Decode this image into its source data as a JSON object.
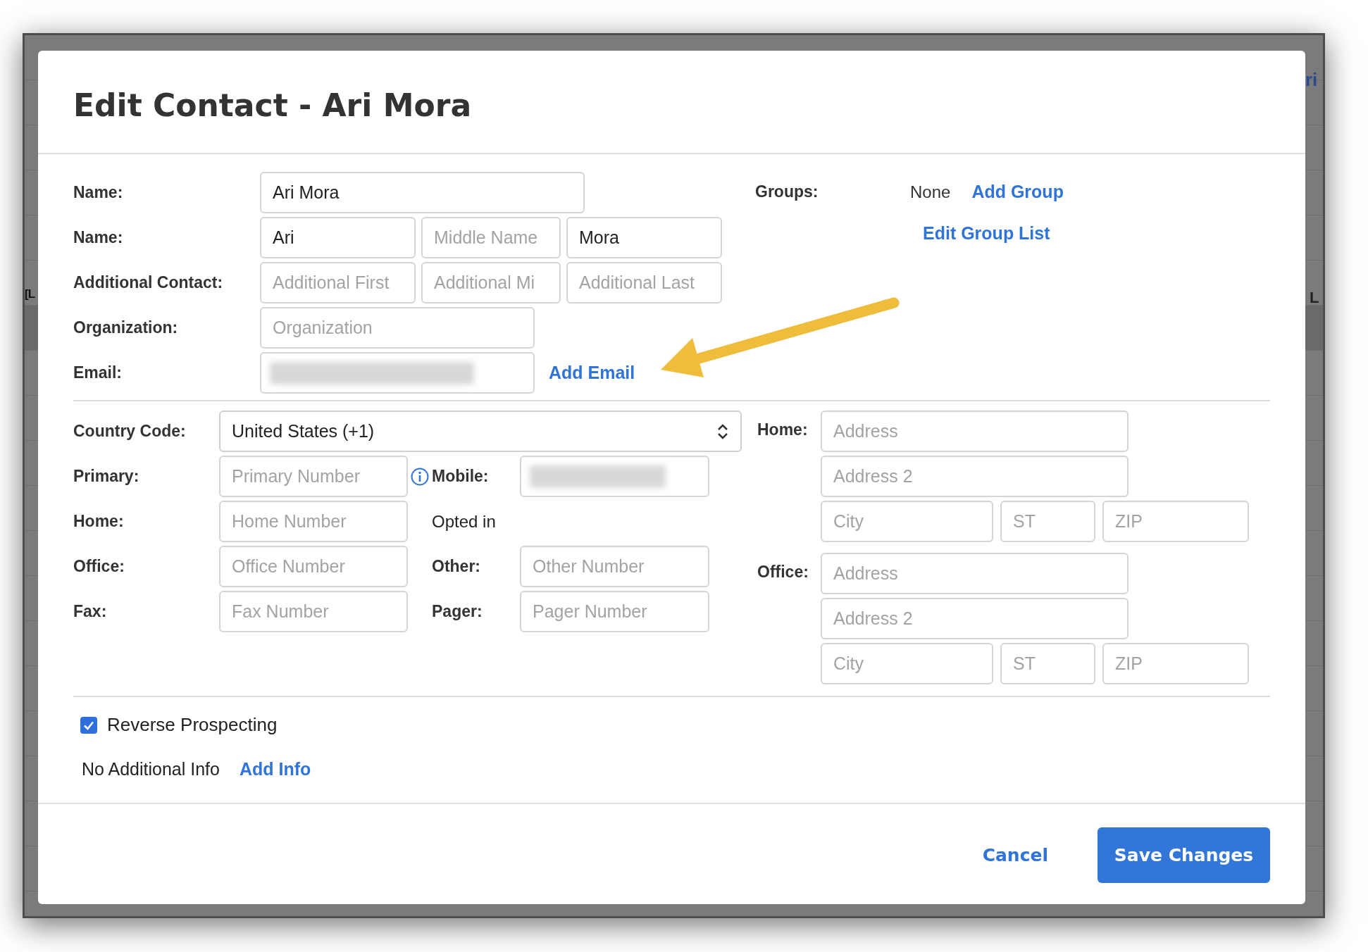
{
  "background": {
    "corner_text": "ri",
    "left_text": "[L",
    "right_text": "L"
  },
  "dialog": {
    "title": "Edit Contact - Ari Mora",
    "name_rows": [
      {
        "label": "Name:",
        "fields": [
          {
            "value": "Ari Mora"
          }
        ]
      },
      {
        "label": "Name:",
        "fields": [
          {
            "value": "Ari"
          },
          {
            "placeholder": "Middle Name"
          },
          {
            "value": "Mora"
          }
        ]
      },
      {
        "label": "Additional Contact:",
        "fields": [
          {
            "placeholder": "Additional First"
          },
          {
            "placeholder": "Additional Mi"
          },
          {
            "placeholder": "Additional Last"
          }
        ]
      },
      {
        "label": "Organization:",
        "fields": [
          {
            "placeholder": "Organization"
          }
        ]
      },
      {
        "label": "Email:",
        "fields": [
          {
            "blurred": true
          }
        ],
        "link": "Add Email"
      }
    ],
    "groups": {
      "label": "Groups:",
      "value": "None",
      "add_link": "Add Group",
      "edit_link": "Edit Group List"
    },
    "country_code": {
      "label": "Country Code:",
      "value": "United States (+1)"
    },
    "phones": [
      {
        "label": "Primary:",
        "placeholder": "Primary Number",
        "info": true,
        "right": {
          "kind": "field",
          "label": "Mobile:",
          "blurred": true
        }
      },
      {
        "label": "Home:",
        "placeholder": "Home Number",
        "info": false,
        "right": {
          "kind": "text",
          "text": "Opted in"
        }
      },
      {
        "label": "Office:",
        "placeholder": "Office Number",
        "info": false,
        "right": {
          "kind": "field",
          "label": "Other:",
          "placeholder": "Other Number"
        }
      },
      {
        "label": "Fax:",
        "placeholder": "Fax Number",
        "info": false,
        "right": {
          "kind": "field",
          "label": "Pager:",
          "placeholder": "Pager Number"
        }
      }
    ],
    "addresses": [
      {
        "label": "Home:",
        "fields": [
          {
            "placeholder": "Address"
          },
          {
            "placeholder": "Address 2"
          },
          {
            "placeholder": "City"
          },
          {
            "placeholder": "ST"
          },
          {
            "placeholder": "ZIP"
          }
        ]
      },
      {
        "label": "Office:",
        "fields": [
          {
            "placeholder": "Address"
          },
          {
            "placeholder": "Address 2"
          },
          {
            "placeholder": "City"
          },
          {
            "placeholder": "ST"
          },
          {
            "placeholder": "ZIP"
          }
        ]
      }
    ],
    "reverse_prospecting": {
      "label": "Reverse Prospecting",
      "checked": true
    },
    "additional_info": {
      "text": "No Additional Info",
      "link": "Add Info"
    },
    "footer": {
      "cancel": "Cancel",
      "save": "Save Changes"
    }
  }
}
